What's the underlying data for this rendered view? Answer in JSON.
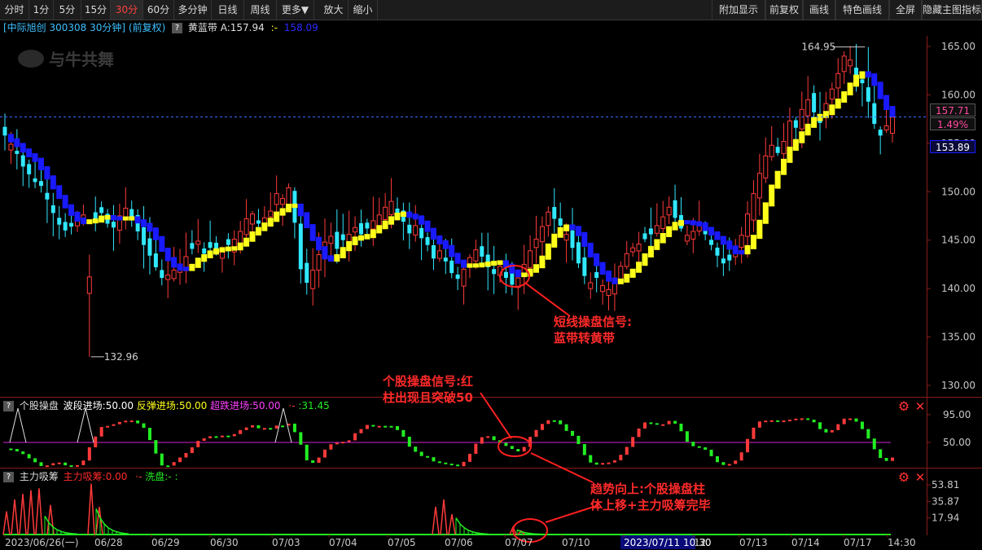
{
  "toolbar": {
    "left": [
      "分时",
      "1分",
      "5分",
      "15分",
      "30分",
      "60分",
      "多分钟",
      "日线",
      "周线",
      "更多▼",
      "放大",
      "缩小"
    ],
    "active_index": 4,
    "right": [
      "附加显示",
      "前复权",
      "画线",
      "特色画线",
      "全屏",
      "隐藏主图指标"
    ]
  },
  "info": {
    "stock": "[中际旭创 300308 30分钟] (前复权)",
    "indicator": "黄蓝带 A:157.94",
    "indicator_sep": ":-",
    "indicator_b": "158.09"
  },
  "watermark": "与牛共舞",
  "price_axis": [
    "165.00",
    "160.00",
    "155.00",
    "150.00",
    "145.00",
    "140.00",
    "135.00",
    "130.00"
  ],
  "price_tags": {
    "current": "157.71",
    "percent": "1.49%",
    "other": "153.89"
  },
  "high_label": "164.95",
  "low_label": "132.96",
  "panel2": {
    "title": "个股操盘",
    "a": "波段进场:50.00",
    "b": "反弹进场:50.00",
    "c": "超跌进场:50.00",
    "d": "·-",
    "e": ":31.45",
    "axis": [
      "95.00",
      "50.00"
    ]
  },
  "panel3": {
    "title": "主力吸筹",
    "a": "主力吸筹:0.00",
    "b": "·-",
    "c": "洗盘:-",
    "d": ":",
    "axis": [
      "53.81",
      "35.87",
      "17.94"
    ]
  },
  "notes": {
    "n1_line1": "短线操盘信号:",
    "n1_line2": "蓝带转黄带",
    "n2_line1": "个股操盘信号:红",
    "n2_line2": "柱出现且突破50",
    "n3_line1": "趋势向上:个股操盘柱",
    "n3_line2": "体上移+主力吸筹完毕"
  },
  "dates": [
    "2023/06/26(一)",
    "06/28",
    "06/29",
    "06/30",
    "07/03",
    "07/04",
    "07/05",
    "07/06",
    "07/07",
    "07/10",
    "2023/07/11 10:30",
    "12",
    "07/13",
    "07/14",
    "07/17",
    "14:30"
  ],
  "colors": {
    "up": "#ff3a3a",
    "down": "#30e8ff",
    "yellow": "#ffff1a",
    "blue": "#1a1aff",
    "green": "#22ee22"
  },
  "chart_data": {
    "type": "candlestick",
    "ylim": [
      130,
      166
    ],
    "closes": [
      155.8,
      154.9,
      153.9,
      152.6,
      151.8,
      151.0,
      150.6,
      149.2,
      147.8,
      146.6,
      146.0,
      146.4,
      147.0,
      147.6,
      148.3,
      147.1,
      147.8,
      146.7,
      146.3,
      147.5,
      148.3,
      147.2,
      145.9,
      144.5,
      143.4,
      142.2,
      141.1,
      141.4,
      141.9,
      142.5,
      143.3,
      144.1,
      144.9,
      143.6,
      144.2,
      143.8,
      144.0,
      144.5,
      145.1,
      145.9,
      147.2,
      147.7,
      146.7,
      147.3,
      148.0,
      149.8,
      149.3,
      150.4,
      146.8,
      142.0,
      140.6,
      141.9,
      143.5,
      144.8,
      145.4,
      144.1,
      145.0,
      145.6,
      146.3,
      145.6,
      146.2,
      147.0,
      147.6,
      148.4,
      149.0,
      147.8,
      146.9,
      145.7,
      146.5,
      145.2,
      144.5,
      143.1,
      143.9,
      142.8,
      141.6,
      141.0,
      142.0,
      143.2,
      144.0,
      143.3,
      142.2,
      141.5,
      142.3,
      141.1,
      140.4,
      141.1,
      142.5,
      143.9,
      145.1,
      146.4,
      147.9,
      147.2,
      146.5,
      145.6,
      144.2,
      142.6,
      141.3,
      140.6,
      141.1,
      140.3,
      139.9,
      141.0,
      142.3,
      143.6,
      144.2,
      144.6,
      145.1,
      145.6,
      146.5,
      147.4,
      148.4,
      147.3,
      146.2,
      145.5,
      145.9,
      146.7,
      145.6,
      144.5,
      143.4,
      142.6,
      142.9,
      143.8,
      145.5,
      147.7,
      149.8,
      151.9,
      153.7,
      154.8,
      154.0,
      155.2,
      157.3,
      156.6,
      158.5,
      159.5,
      158.2,
      157.1,
      159.1,
      160.6,
      162.2,
      164.0,
      163.6,
      162.0,
      161.2,
      159.3,
      157.0,
      155.8,
      156.8,
      157.7
    ],
    "high": 164.95,
    "low": 132.96
  }
}
